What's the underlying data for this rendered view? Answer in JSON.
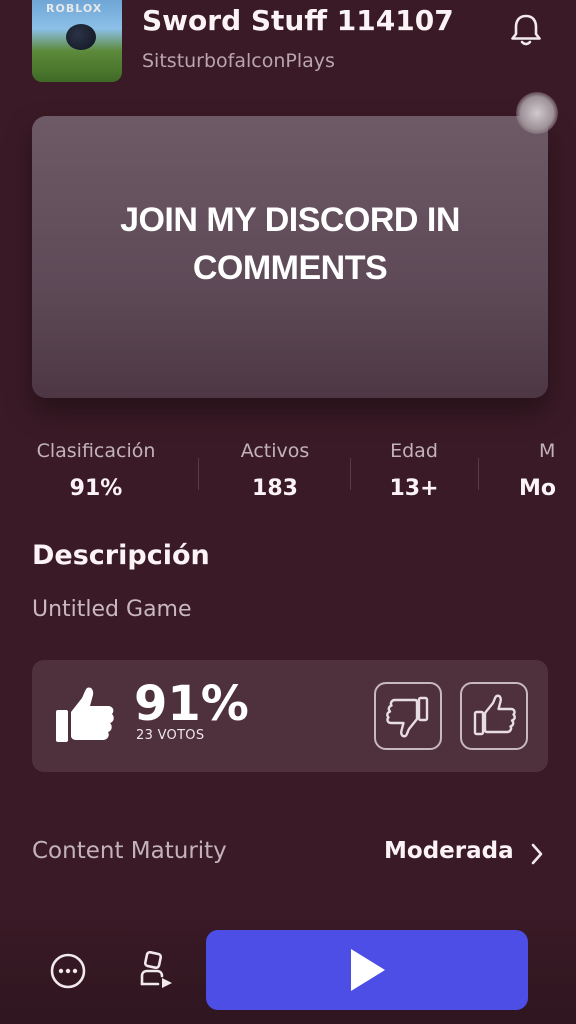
{
  "header": {
    "thumbnail_logo": "ROBLOX",
    "title": "Sword Stuff 114107",
    "creator": "SitsturbofalconPlays"
  },
  "banner": {
    "text": "JOIN MY DISCORD IN\nCOMMENTS"
  },
  "stats": [
    {
      "label": "Clasificación",
      "value": "91%"
    },
    {
      "label": "Activos",
      "value": "183"
    },
    {
      "label": "Edad",
      "value": "13+"
    },
    {
      "label": "M",
      "value": "Mo"
    }
  ],
  "description": {
    "heading": "Descripción",
    "text": "Untitled Game"
  },
  "votes": {
    "percent": "91%",
    "count_label": "23 VOTOS"
  },
  "content_maturity": {
    "label": "Content Maturity",
    "value": "Moderada"
  },
  "colors": {
    "background": "#3a1a26",
    "play_button": "#4d4ee6"
  },
  "icons": [
    "bell-icon",
    "thumbs-up-icon",
    "thumbs-down-icon",
    "chevron-right-icon",
    "more-icon",
    "party-icon",
    "play-icon"
  ]
}
